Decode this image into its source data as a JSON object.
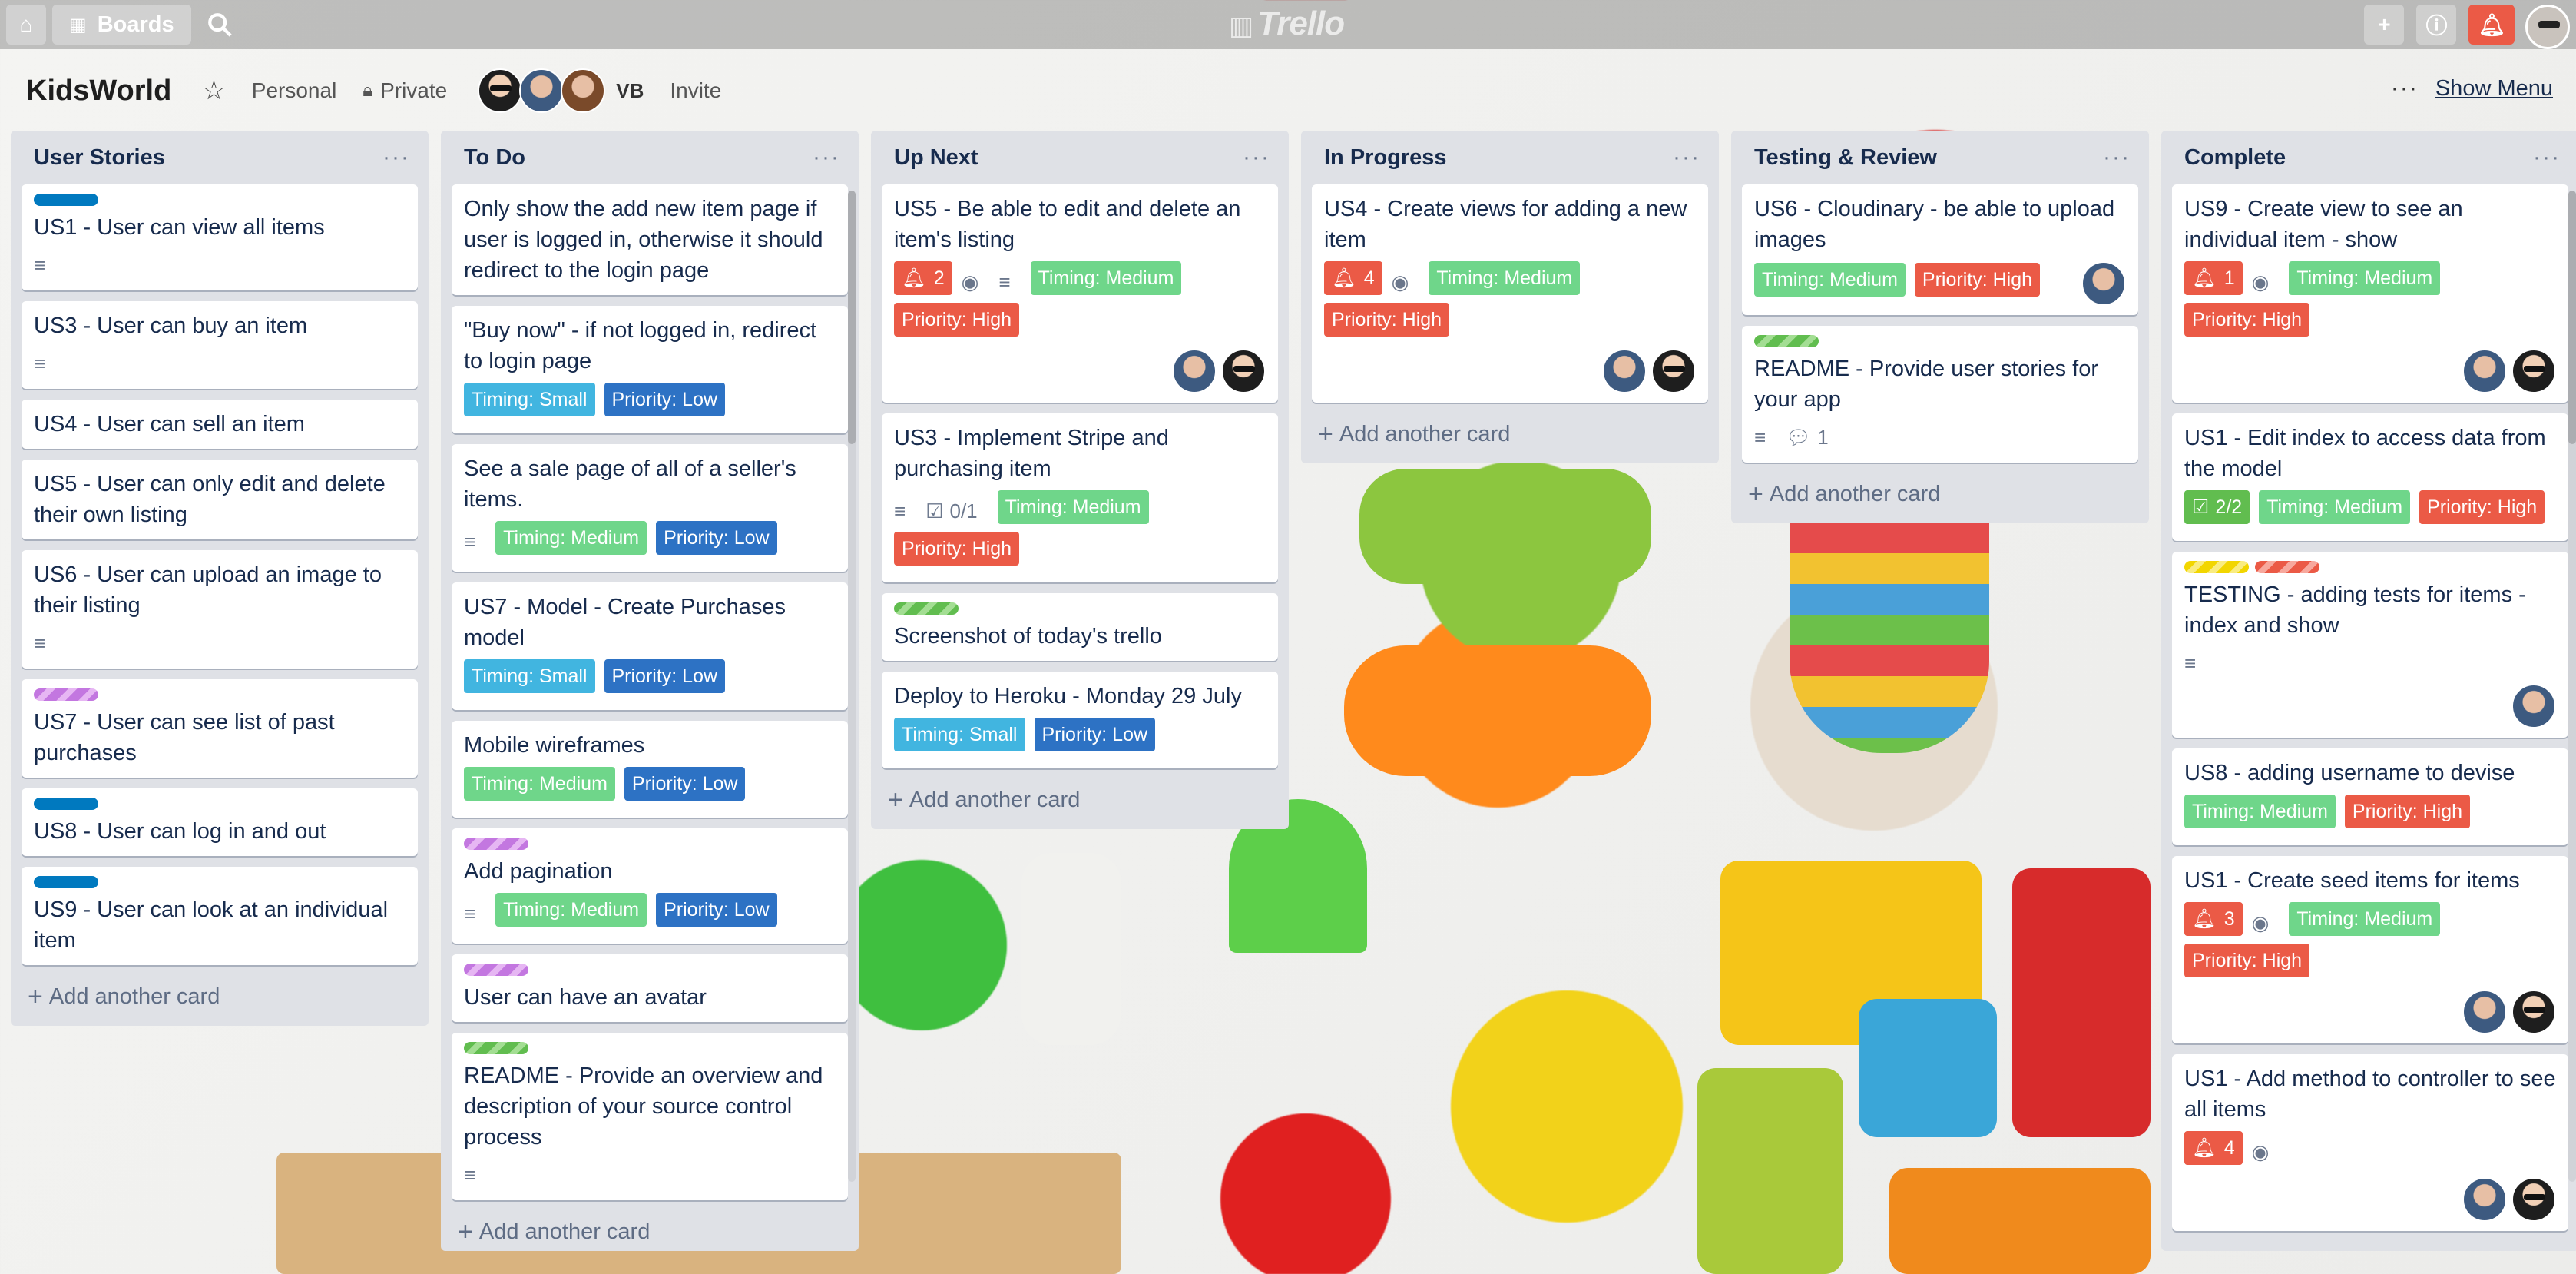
{
  "topbar": {
    "boards_label": "Boards",
    "logo_text": "Trello"
  },
  "board": {
    "title": "KidsWorld",
    "team_label": "Personal",
    "visibility_label": "Private",
    "member_initials": "VB",
    "invite_label": "Invite",
    "show_menu_label": "Show Menu"
  },
  "lists": [
    {
      "title": "User Stories",
      "add_label": "Add another card",
      "cards": [
        {
          "strips": [
            "blue"
          ],
          "title": "US1 - User can view all items",
          "desc": true
        },
        {
          "title": "US3 - User can buy an item",
          "desc": true
        },
        {
          "title": "US4 - User can sell an item"
        },
        {
          "title": "US5 - User can only edit and delete their own listing"
        },
        {
          "title": "US6 - User can upload an image to their listing",
          "desc": true
        },
        {
          "strips": [
            "purple"
          ],
          "title": "US7 - User can see list of past purchases"
        },
        {
          "strips": [
            "blue"
          ],
          "title": "US8 - User can log in and out"
        },
        {
          "strips": [
            "blue"
          ],
          "title": "US9 - User can look at an individual item"
        }
      ]
    },
    {
      "title": "To Do",
      "add_label": "Add another card",
      "cards": [
        {
          "title": "Only show the add new item page if user is logged in, otherwise it should redirect to the login page"
        },
        {
          "title": "\"Buy now\" - if not logged in, redirect to login page",
          "chips": [
            {
              "t": "Timing: Small",
              "c": "tm-small"
            },
            {
              "t": "Priority: Low",
              "c": "pr-low"
            }
          ]
        },
        {
          "title": "See a sale page of all of a seller's items.",
          "desc": true,
          "chips": [
            {
              "t": "Timing: Medium",
              "c": "tm-medium"
            },
            {
              "t": "Priority: Low",
              "c": "pr-low"
            }
          ]
        },
        {
          "title": "US7 - Model - Create Purchases model",
          "chips": [
            {
              "t": "Timing: Small",
              "c": "tm-small"
            },
            {
              "t": "Priority: Low",
              "c": "pr-low"
            }
          ]
        },
        {
          "title": "Mobile wireframes",
          "chips": [
            {
              "t": "Timing: Medium",
              "c": "tm-medium"
            },
            {
              "t": "Priority: Low",
              "c": "pr-low"
            }
          ]
        },
        {
          "strips": [
            "purple"
          ],
          "title": "Add pagination",
          "desc": true,
          "chips": [
            {
              "t": "Timing: Medium",
              "c": "tm-medium"
            },
            {
              "t": "Priority: Low",
              "c": "pr-low"
            }
          ]
        },
        {
          "strips": [
            "purple"
          ],
          "title": "User can have an avatar"
        },
        {
          "strips": [
            "green"
          ],
          "title": "README - Provide an overview and description of your source control process",
          "desc": true
        }
      ]
    },
    {
      "title": "Up Next",
      "add_label": "Add another card",
      "cards": [
        {
          "title": "US5 - Be able to edit and delete an item's listing",
          "alert": "2",
          "watch": true,
          "desc": true,
          "chips": [
            {
              "t": "Timing: Medium",
              "c": "tm-medium"
            },
            {
              "t": "Priority: High",
              "c": "pr-high"
            }
          ],
          "members": [
            "a",
            "b"
          ]
        },
        {
          "title": "US3 - Implement Stripe and purchasing item",
          "desc": true,
          "check": "0/1",
          "chips": [
            {
              "t": "Timing: Medium",
              "c": "tm-medium"
            },
            {
              "t": "Priority: High",
              "c": "pr-high"
            }
          ]
        },
        {
          "strips": [
            "green"
          ],
          "title": "Screenshot of today's trello"
        },
        {
          "title": "Deploy to Heroku - Monday 29 July",
          "chips": [
            {
              "t": "Timing: Small",
              "c": "tm-small"
            },
            {
              "t": "Priority: Low",
              "c": "pr-low"
            }
          ]
        }
      ]
    },
    {
      "title": "In Progress",
      "add_label": "Add another card",
      "cards": [
        {
          "title": "US4 - Create views for adding a new item",
          "alert": "4",
          "watch": true,
          "chips": [
            {
              "t": "Timing: Medium",
              "c": "tm-medium"
            },
            {
              "t": "Priority: High",
              "c": "pr-high"
            }
          ],
          "members": [
            "a",
            "b"
          ]
        }
      ]
    },
    {
      "title": "Testing & Review",
      "add_label": "Add another card",
      "cards": [
        {
          "title": "US6 - Cloudinary - be able to upload images",
          "chips": [
            {
              "t": "Timing: Medium",
              "c": "tm-medium"
            },
            {
              "t": "Priority: High",
              "c": "pr-high"
            }
          ],
          "members_inline": [
            "a"
          ]
        },
        {
          "strips": [
            "green"
          ],
          "title": "README - Provide user stories for your app",
          "desc": true,
          "comments": "1"
        }
      ]
    },
    {
      "title": "Complete",
      "add_label": "Add another card",
      "cards": [
        {
          "title": "US9 - Create view to see an individual item - show",
          "alert": "1",
          "watch": true,
          "chips": [
            {
              "t": "Timing: Medium",
              "c": "tm-medium"
            },
            {
              "t": "Priority: High",
              "c": "pr-high"
            }
          ],
          "members": [
            "a",
            "b"
          ]
        },
        {
          "title": "US1 - Edit index to access data from the model",
          "check_done": "2/2",
          "chips": [
            {
              "t": "Timing: Medium",
              "c": "tm-medium"
            },
            {
              "t": "Priority: High",
              "c": "pr-high"
            }
          ]
        },
        {
          "strips": [
            "yellow",
            "red"
          ],
          "title": "TESTING - adding tests for items - index and show",
          "desc": true,
          "members": [
            "a"
          ]
        },
        {
          "title": "US8 - adding username to devise",
          "chips": [
            {
              "t": "Timing: Medium",
              "c": "tm-medium"
            },
            {
              "t": "Priority: High",
              "c": "pr-high"
            }
          ]
        },
        {
          "title": "US1 - Create seed items for items",
          "alert": "3",
          "watch": true,
          "chips": [
            {
              "t": "Timing: Medium",
              "c": "tm-medium"
            },
            {
              "t": "Priority: High",
              "c": "pr-high"
            }
          ],
          "members": [
            "a",
            "b"
          ]
        },
        {
          "title": "US1 - Add method to controller to see all items",
          "alert": "4",
          "watch": true,
          "members": [
            "a",
            "b"
          ]
        }
      ]
    }
  ]
}
